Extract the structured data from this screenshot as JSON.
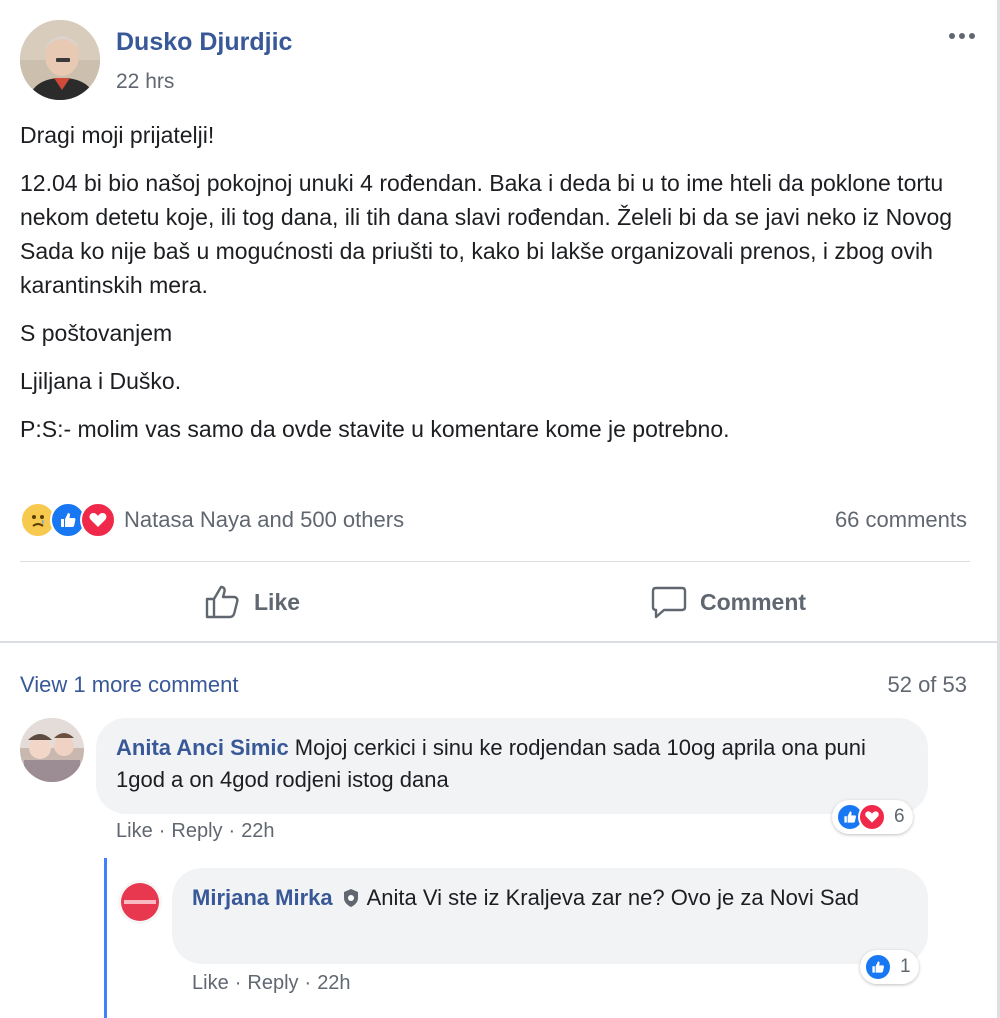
{
  "post": {
    "author": "Dusko Djurdjic",
    "time": "22 hrs",
    "paragraphs": [
      "Dragi moji prijatelji!",
      "12.04 bi bio našoj pokojnoj unuki 4 rođendan. Baka i deda bi u to ime hteli da poklone tortu nekom detetu koje, ili tog dana, ili tih dana slavi rođendan. Želeli bi da se javi neko iz Novog Sada ko nije baš u mogućnosti da priušti to, kako bi lakše organizovali prenos, i zbog ovih karantinskih mera.",
      "S poštovanjem",
      "Ljiljana i Duško.",
      "P:S:- molim vas samo da ovde stavite u komentare kome je potrebno."
    ],
    "reactors_text": "Natasa Naya and 500 others",
    "comments_count": "66 comments"
  },
  "actions": {
    "like": "Like",
    "comment": "Comment"
  },
  "comments_header": {
    "view_more": "View 1 more comment",
    "pager": "52 of 53"
  },
  "comments": [
    {
      "name": "Anita Anci Simic",
      "text": "Mojoj cerkici i sinu ke rodjendan sada 10og aprila ona puni 1god a on 4god rodjeni istog dana",
      "like_label": "Like",
      "reply_label": "Reply",
      "time": "22h",
      "reaction_count": "6"
    },
    {
      "name": "Mirjana Mirka",
      "text": "Anita Vi ste iz Kraljeva zar ne? Ovo je za Novi Sad",
      "like_label": "Like",
      "reply_label": "Reply",
      "time": "22h",
      "reaction_count": "1"
    }
  ],
  "colors": {
    "link_blue": "#385898",
    "like_blue": "#1877f2",
    "love_red": "#f0284a",
    "meta_gray": "#616770",
    "bubble_bg": "#f2f3f5",
    "thread_line": "#4080ff"
  }
}
